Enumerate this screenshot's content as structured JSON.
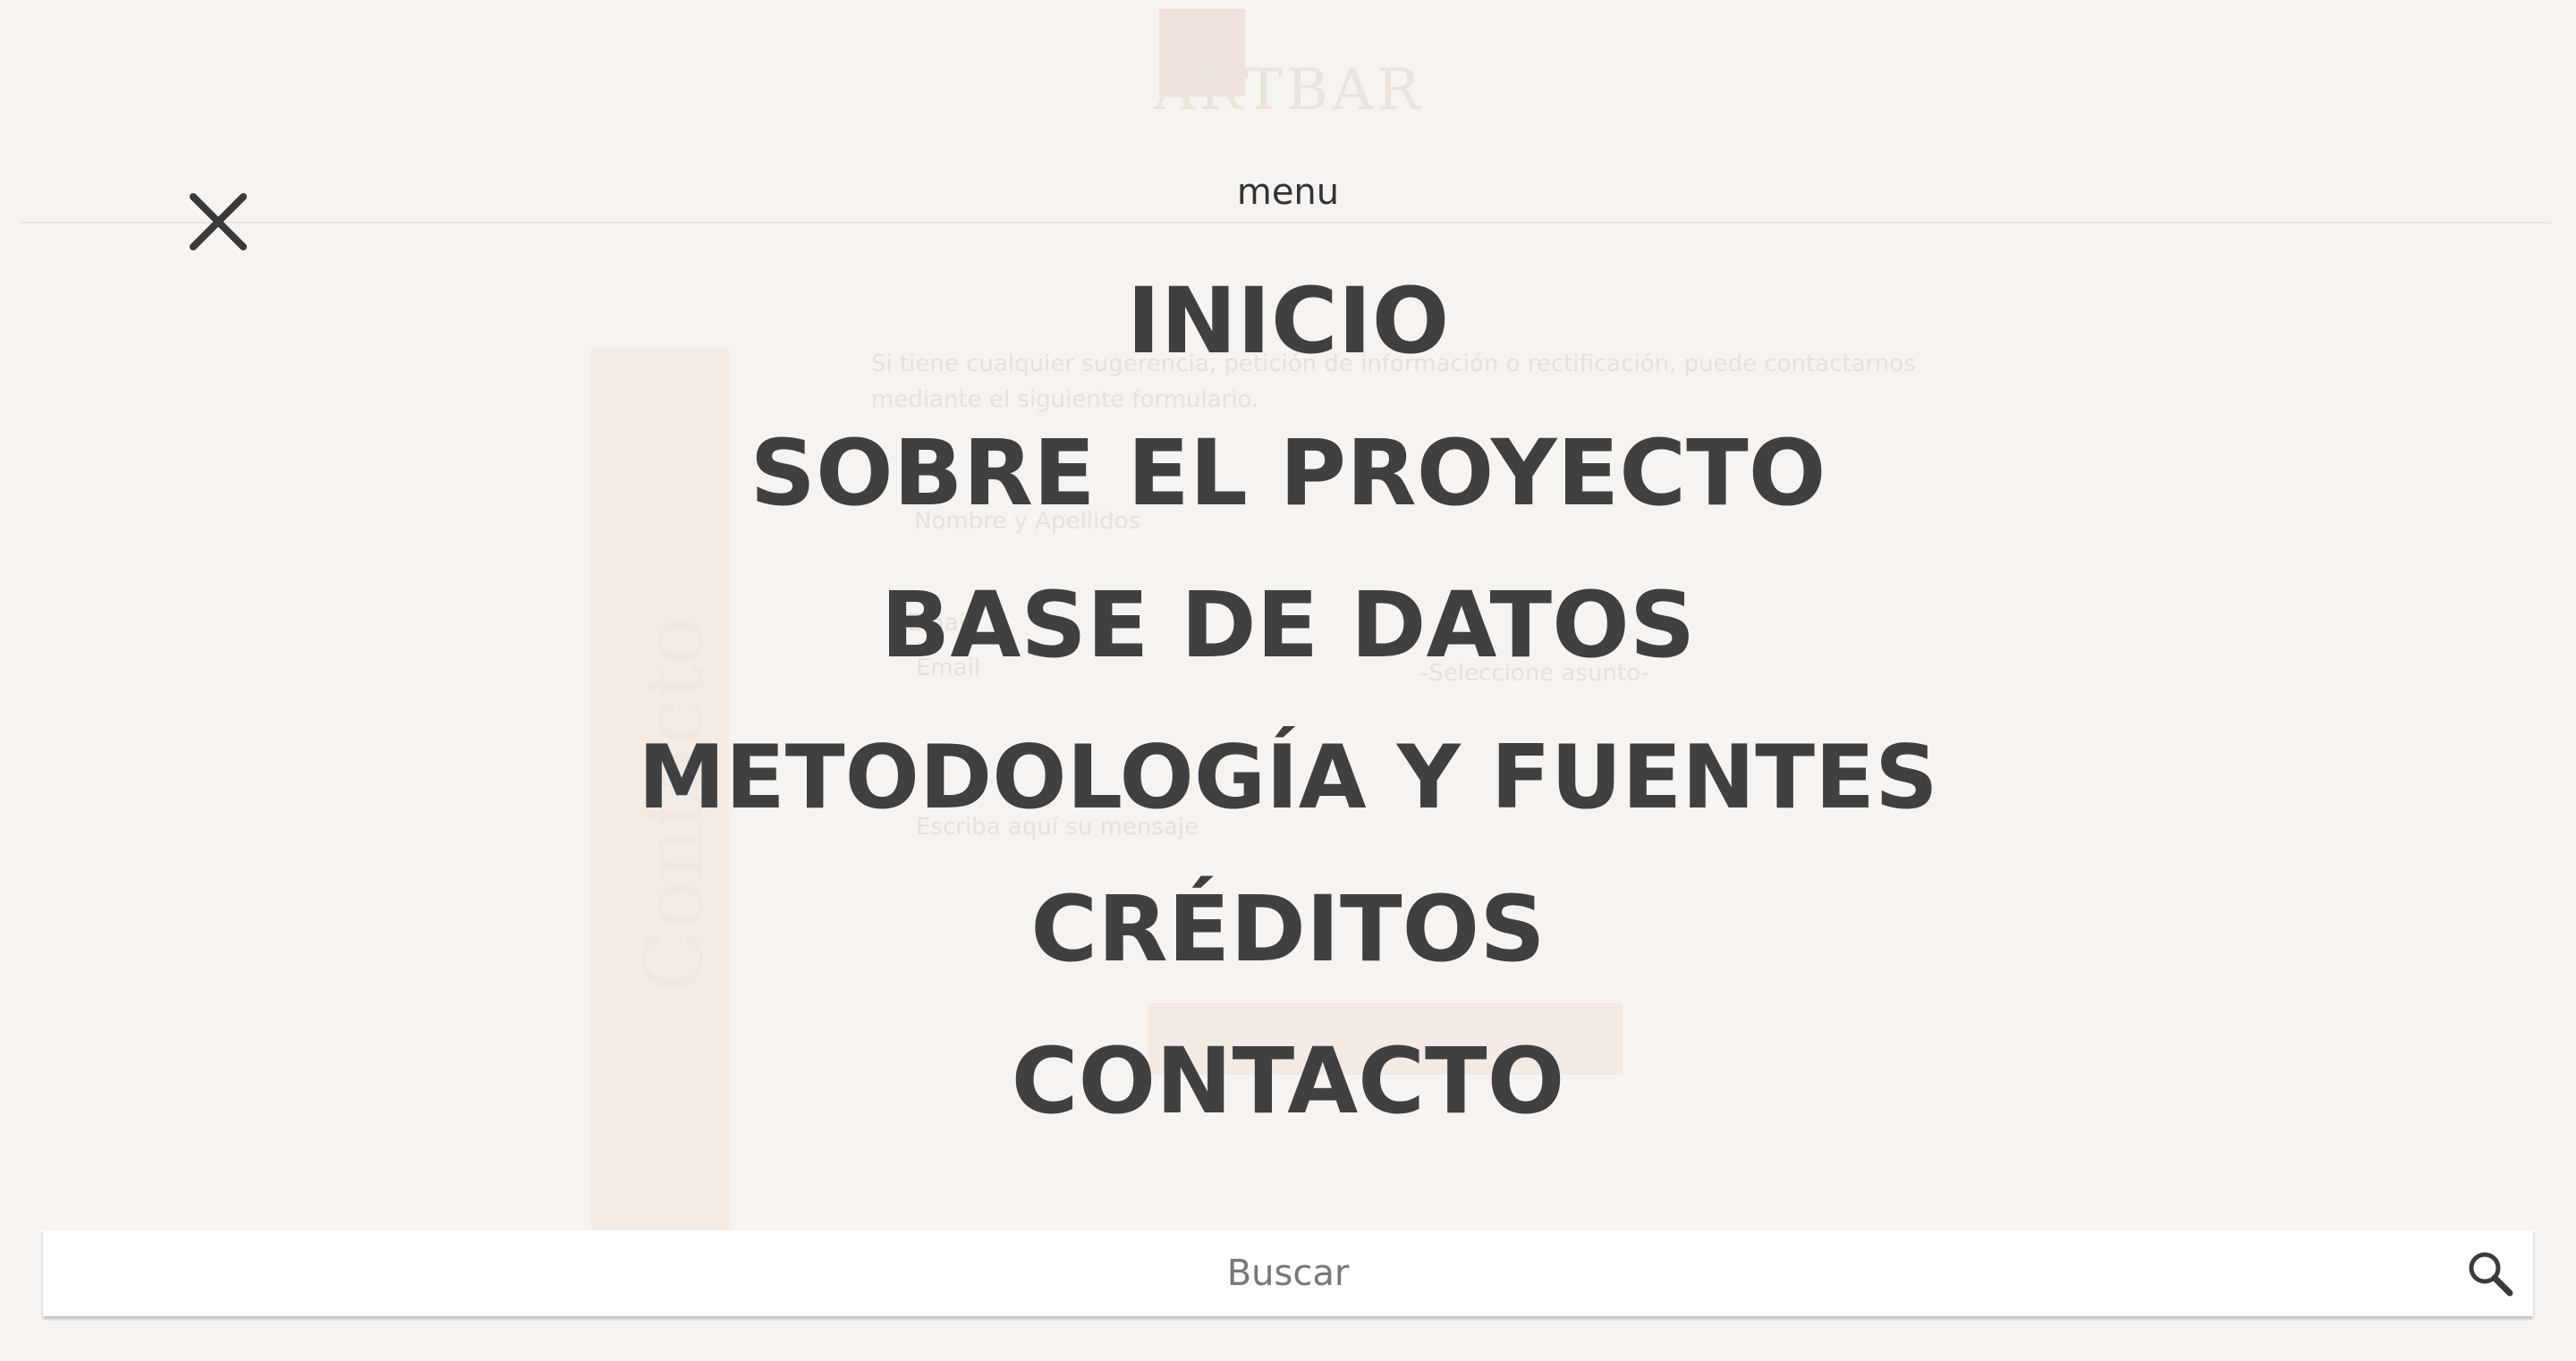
{
  "background_page": {
    "logo_text": "ARTBAR",
    "side_tab_label": "Contacto",
    "intro_line_1": "Si tiene cualquier sugerencia, petición de información o rectificación, puede contactarnos",
    "intro_line_2": "mediante el siguiente formulario.",
    "name_placeholder": "Nombre y Apellidos",
    "email_label": "Email",
    "email_placeholder": "Email",
    "subject_select": "-Seleccione asunto-",
    "message_placeholder": "Escriba aquí su mensaje"
  },
  "menu": {
    "title": "menu",
    "close_icon": "close-icon",
    "items": [
      {
        "label": "INICIO"
      },
      {
        "label": "SOBRE EL PROYECTO"
      },
      {
        "label": "BASE DE DATOS"
      },
      {
        "label": "METODOLOGÍA Y FUENTES"
      },
      {
        "label": "CRÉDITOS"
      },
      {
        "label": "CONTACTO"
      }
    ]
  },
  "search": {
    "placeholder": "Buscar",
    "value": "",
    "icon": "search-icon"
  },
  "colors": {
    "background": "#f7f3f0",
    "menu_text": "#404040",
    "search_background": "#ffffff"
  }
}
